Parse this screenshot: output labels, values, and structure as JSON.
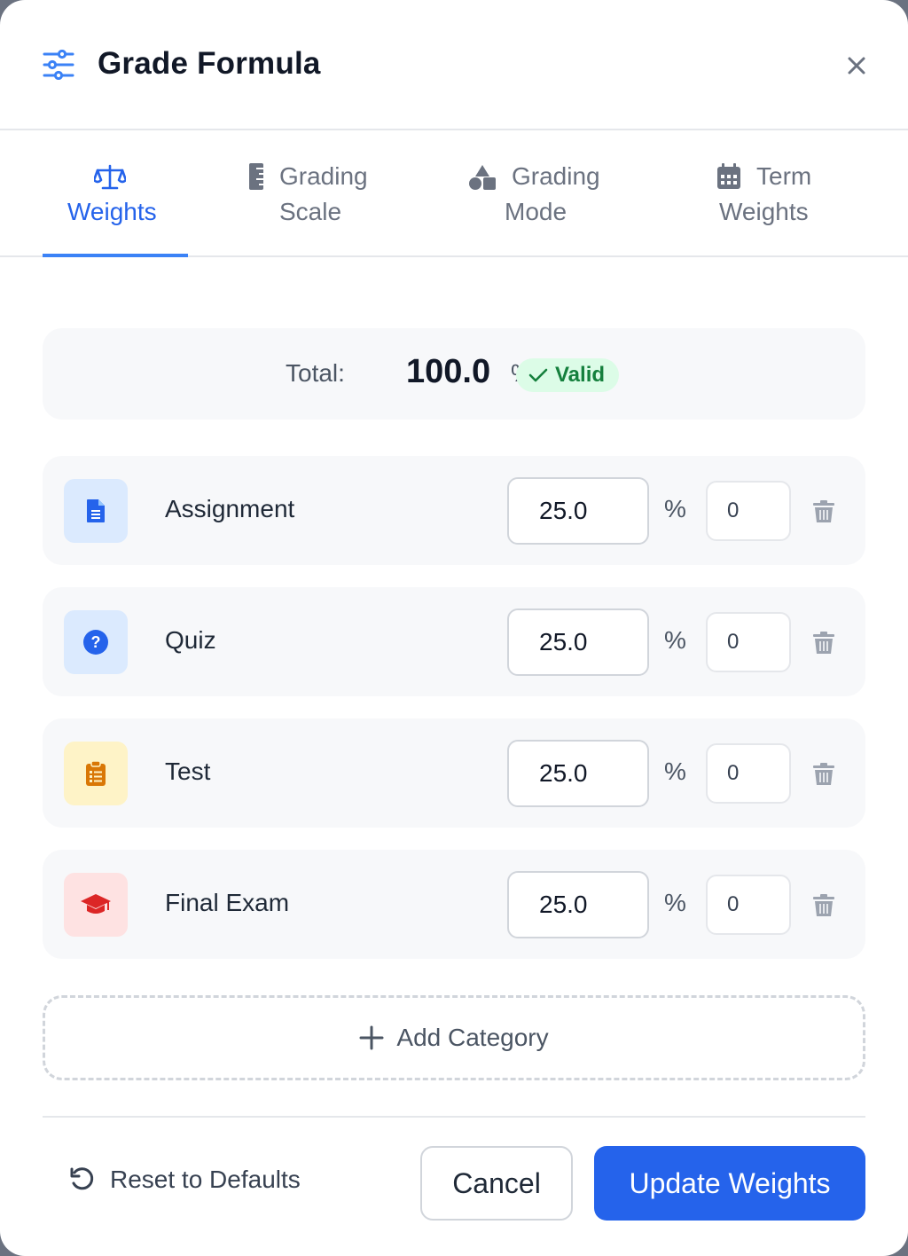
{
  "header": {
    "title": "Grade Formula",
    "icon": "sliders-icon",
    "close_icon": "close-icon"
  },
  "tabs": [
    {
      "line1": "",
      "line2": "Weights",
      "icon": "scale-balance-icon",
      "active": true
    },
    {
      "line1": "Grading",
      "line2": "Scale",
      "icon": "ruler-icon",
      "active": false
    },
    {
      "line1": "Grading",
      "line2": "Mode",
      "icon": "shapes-icon",
      "active": false
    },
    {
      "line1": "Term",
      "line2": "Weights",
      "icon": "calendar-icon",
      "active": false
    }
  ],
  "summary": {
    "label": "Total:",
    "value": "100.0",
    "unit": "%",
    "status": "Valid",
    "status_icon": "check-icon"
  },
  "categories": [
    {
      "name": "Assignment",
      "weight": "25.0",
      "unit": "%",
      "drop": "0",
      "icon": "document-icon",
      "icon_color": "#2563eb",
      "icon_bg": "#dbeafe"
    },
    {
      "name": "Quiz",
      "weight": "25.0",
      "unit": "%",
      "drop": "0",
      "icon": "question-circle-icon",
      "icon_color": "#2563eb",
      "icon_bg": "#dbeafe"
    },
    {
      "name": "Test",
      "weight": "25.0",
      "unit": "%",
      "drop": "0",
      "icon": "clipboard-list-icon",
      "icon_color": "#d97706",
      "icon_bg": "#fef3c7"
    },
    {
      "name": "Final Exam",
      "weight": "25.0",
      "unit": "%",
      "drop": "0",
      "icon": "graduation-cap-icon",
      "icon_color": "#dc2626",
      "icon_bg": "#fee2e2"
    }
  ],
  "actions": {
    "add_category": "Add Category",
    "reset": "Reset to Defaults",
    "cancel": "Cancel",
    "update": "Update Weights"
  },
  "colors": {
    "accent": "#2563eb",
    "valid_bg": "#dcfce7",
    "valid_text": "#15803d"
  }
}
